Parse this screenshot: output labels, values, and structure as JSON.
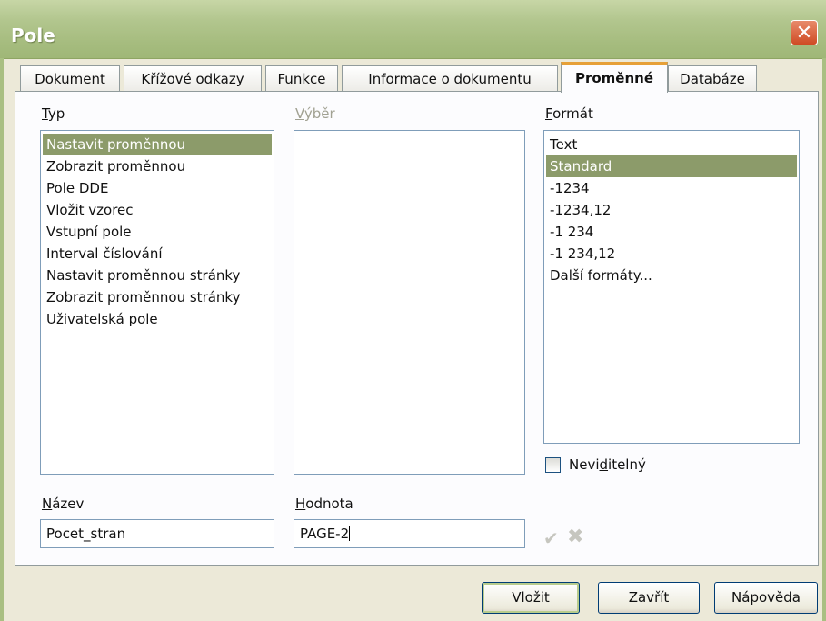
{
  "window": {
    "title": "Pole",
    "close_glyph": "✕"
  },
  "tabs": [
    {
      "label": "Dokument"
    },
    {
      "label": "Křížové odkazy"
    },
    {
      "label": "Funkce"
    },
    {
      "label": "Informace o dokumentu"
    },
    {
      "label": "Proměnné"
    },
    {
      "label": "Databáze"
    }
  ],
  "active_tab": "Proměnné",
  "typ": {
    "label_first": "T",
    "label_rest": "yp",
    "items": [
      "Nastavit proměnnou",
      "Zobrazit proměnnou",
      "Pole DDE",
      "Vložit vzorec",
      "Vstupní pole",
      "Interval číslování",
      "Nastavit proměnnou stránky",
      "Zobrazit proměnnou stránky",
      "Uživatelská pole"
    ],
    "selected_index": 0
  },
  "vyber": {
    "label_first": "V",
    "label_rest": "ýběr"
  },
  "format": {
    "label_first": "F",
    "label_rest": "ormát",
    "items": [
      "Text",
      "Standard",
      "-1234",
      "-1234,12",
      "-1 234",
      "-1 234,12",
      "Další formáty..."
    ],
    "selected_index": 1
  },
  "neviditelny": {
    "label_a": "Nevi",
    "label_u": "d",
    "label_b": "itelný",
    "checked": false
  },
  "nazev": {
    "label_first": "N",
    "label_rest": "ázev",
    "value": "Pocet_stran"
  },
  "hodnota": {
    "label_first": "H",
    "label_rest": "odnota",
    "value": "PAGE-2"
  },
  "icons": {
    "apply": "✔",
    "cancel": "✖"
  },
  "buttons": {
    "insert": "Vložit",
    "close": "Zavřít",
    "help": "Nápověda"
  },
  "colors": {
    "titlebar": "#a9bf82",
    "selection": "#8c9b6a",
    "active_tab_accent": "#e6a038"
  }
}
